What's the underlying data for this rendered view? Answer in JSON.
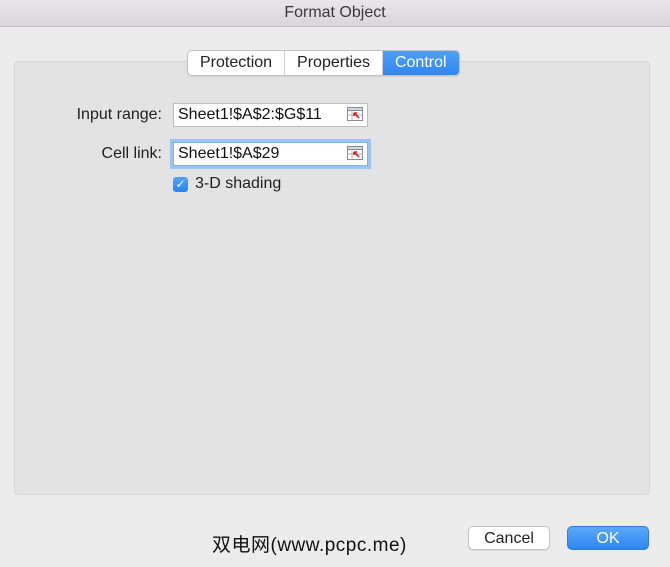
{
  "window": {
    "title": "Format Object"
  },
  "tabs": [
    {
      "label": "Protection",
      "active": false
    },
    {
      "label": "Properties",
      "active": false
    },
    {
      "label": "Control",
      "active": true
    }
  ],
  "form": {
    "input_range_label": "Input range:",
    "input_range_value": "Sheet1!$A$2:$G$11",
    "cell_link_label": "Cell link:",
    "cell_link_value": "Sheet1!$A$29",
    "shading_label": "3-D shading",
    "shading_checked": true
  },
  "buttons": {
    "cancel": "Cancel",
    "ok": "OK"
  },
  "watermark": "双电网(www.pcpc.me)",
  "colors": {
    "accent": "#2f86f2",
    "panel": "#e3e3e3",
    "window": "#ececec"
  },
  "icons": {
    "range_selector": "range-selector-icon",
    "check": "checkmark-icon"
  }
}
